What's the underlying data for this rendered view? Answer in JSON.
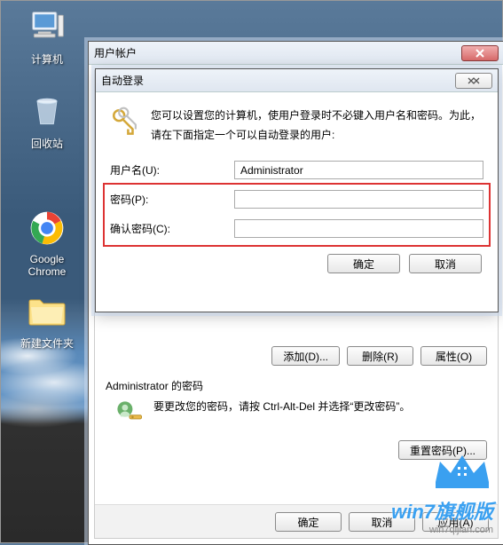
{
  "desktop": {
    "computer": "计算机",
    "recycle": "回收站",
    "chrome": "Google Chrome",
    "folder": "新建文件夹"
  },
  "parentWindow": {
    "title": "用户帐户",
    "buttons": {
      "add": "添加(D)...",
      "delete": "删除(R)",
      "properties": "属性(O)"
    },
    "passwordSection": {
      "title": "Administrator 的密码",
      "text": "要更改您的密码，请按 Ctrl-Alt-Del 并选择“更改密码”。",
      "resetBtn": "重置密码(P)..."
    },
    "footer": {
      "ok": "确定",
      "cancel": "取消",
      "apply": "应用(A)"
    }
  },
  "childDialog": {
    "title": "自动登录",
    "infoText": "您可以设置您的计算机，使用户登录时不必键入用户名和密码。为此，请在下面指定一个可以自动登录的用户:",
    "fields": {
      "usernameLabel": "用户名(U):",
      "usernameValue": "Administrator",
      "passwordLabel": "密码(P):",
      "passwordValue": "",
      "confirmLabel": "确认密码(C):",
      "confirmValue": ""
    },
    "buttons": {
      "ok": "确定",
      "cancel": "取消"
    }
  },
  "watermark": {
    "line1": "win7旗舰版",
    "line2": "win7qijian.com"
  }
}
